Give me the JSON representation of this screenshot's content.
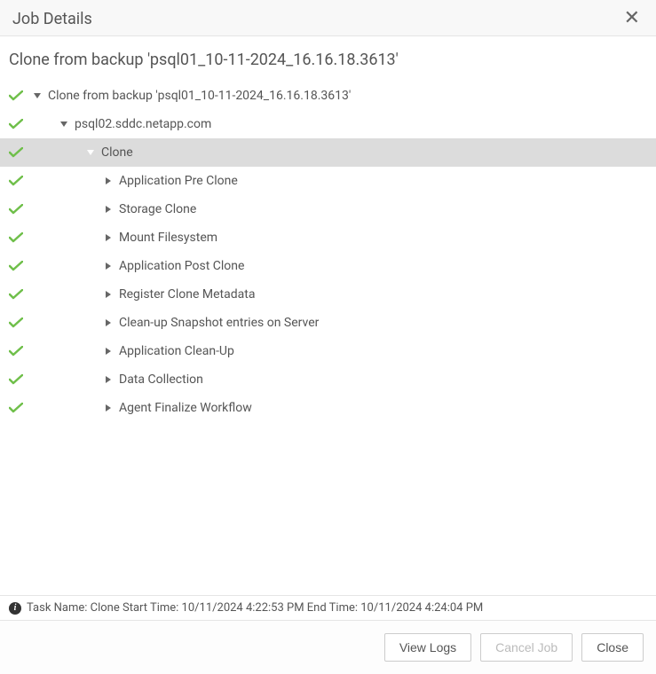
{
  "header": {
    "title": "Job Details"
  },
  "subtitle": "Clone from backup 'psql01_10-11-2024_16.16.18.3613'",
  "tree": [
    {
      "indent": 0,
      "status": "success",
      "expand": "down",
      "label": "Clone from backup 'psql01_10-11-2024_16.16.18.3613'",
      "selected": false
    },
    {
      "indent": 1,
      "status": "success",
      "expand": "down",
      "label": "psql02.sddc.netapp.com",
      "selected": false
    },
    {
      "indent": 2,
      "status": "success",
      "expand": "down-white",
      "label": "Clone",
      "selected": true
    },
    {
      "indent": 3,
      "status": "success",
      "expand": "right",
      "label": "Application Pre Clone",
      "selected": false
    },
    {
      "indent": 3,
      "status": "success",
      "expand": "right",
      "label": "Storage Clone",
      "selected": false
    },
    {
      "indent": 3,
      "status": "success",
      "expand": "right",
      "label": "Mount Filesystem",
      "selected": false
    },
    {
      "indent": 3,
      "status": "success",
      "expand": "right",
      "label": "Application Post Clone",
      "selected": false
    },
    {
      "indent": 3,
      "status": "success",
      "expand": "right",
      "label": "Register Clone Metadata",
      "selected": false
    },
    {
      "indent": 3,
      "status": "success",
      "expand": "right",
      "label": "Clean-up Snapshot entries on Server",
      "selected": false
    },
    {
      "indent": 3,
      "status": "success",
      "expand": "right",
      "label": "Application Clean-Up",
      "selected": false
    },
    {
      "indent": 3,
      "status": "success",
      "expand": "right",
      "label": "Data Collection",
      "selected": false
    },
    {
      "indent": 3,
      "status": "success",
      "expand": "right",
      "label": "Agent Finalize Workflow",
      "selected": false
    }
  ],
  "statusBar": "Task Name: Clone Start Time: 10/11/2024 4:22:53 PM End Time: 10/11/2024 4:24:04 PM",
  "footer": {
    "viewLogs": "View Logs",
    "cancelJob": "Cancel Job",
    "close": "Close"
  }
}
